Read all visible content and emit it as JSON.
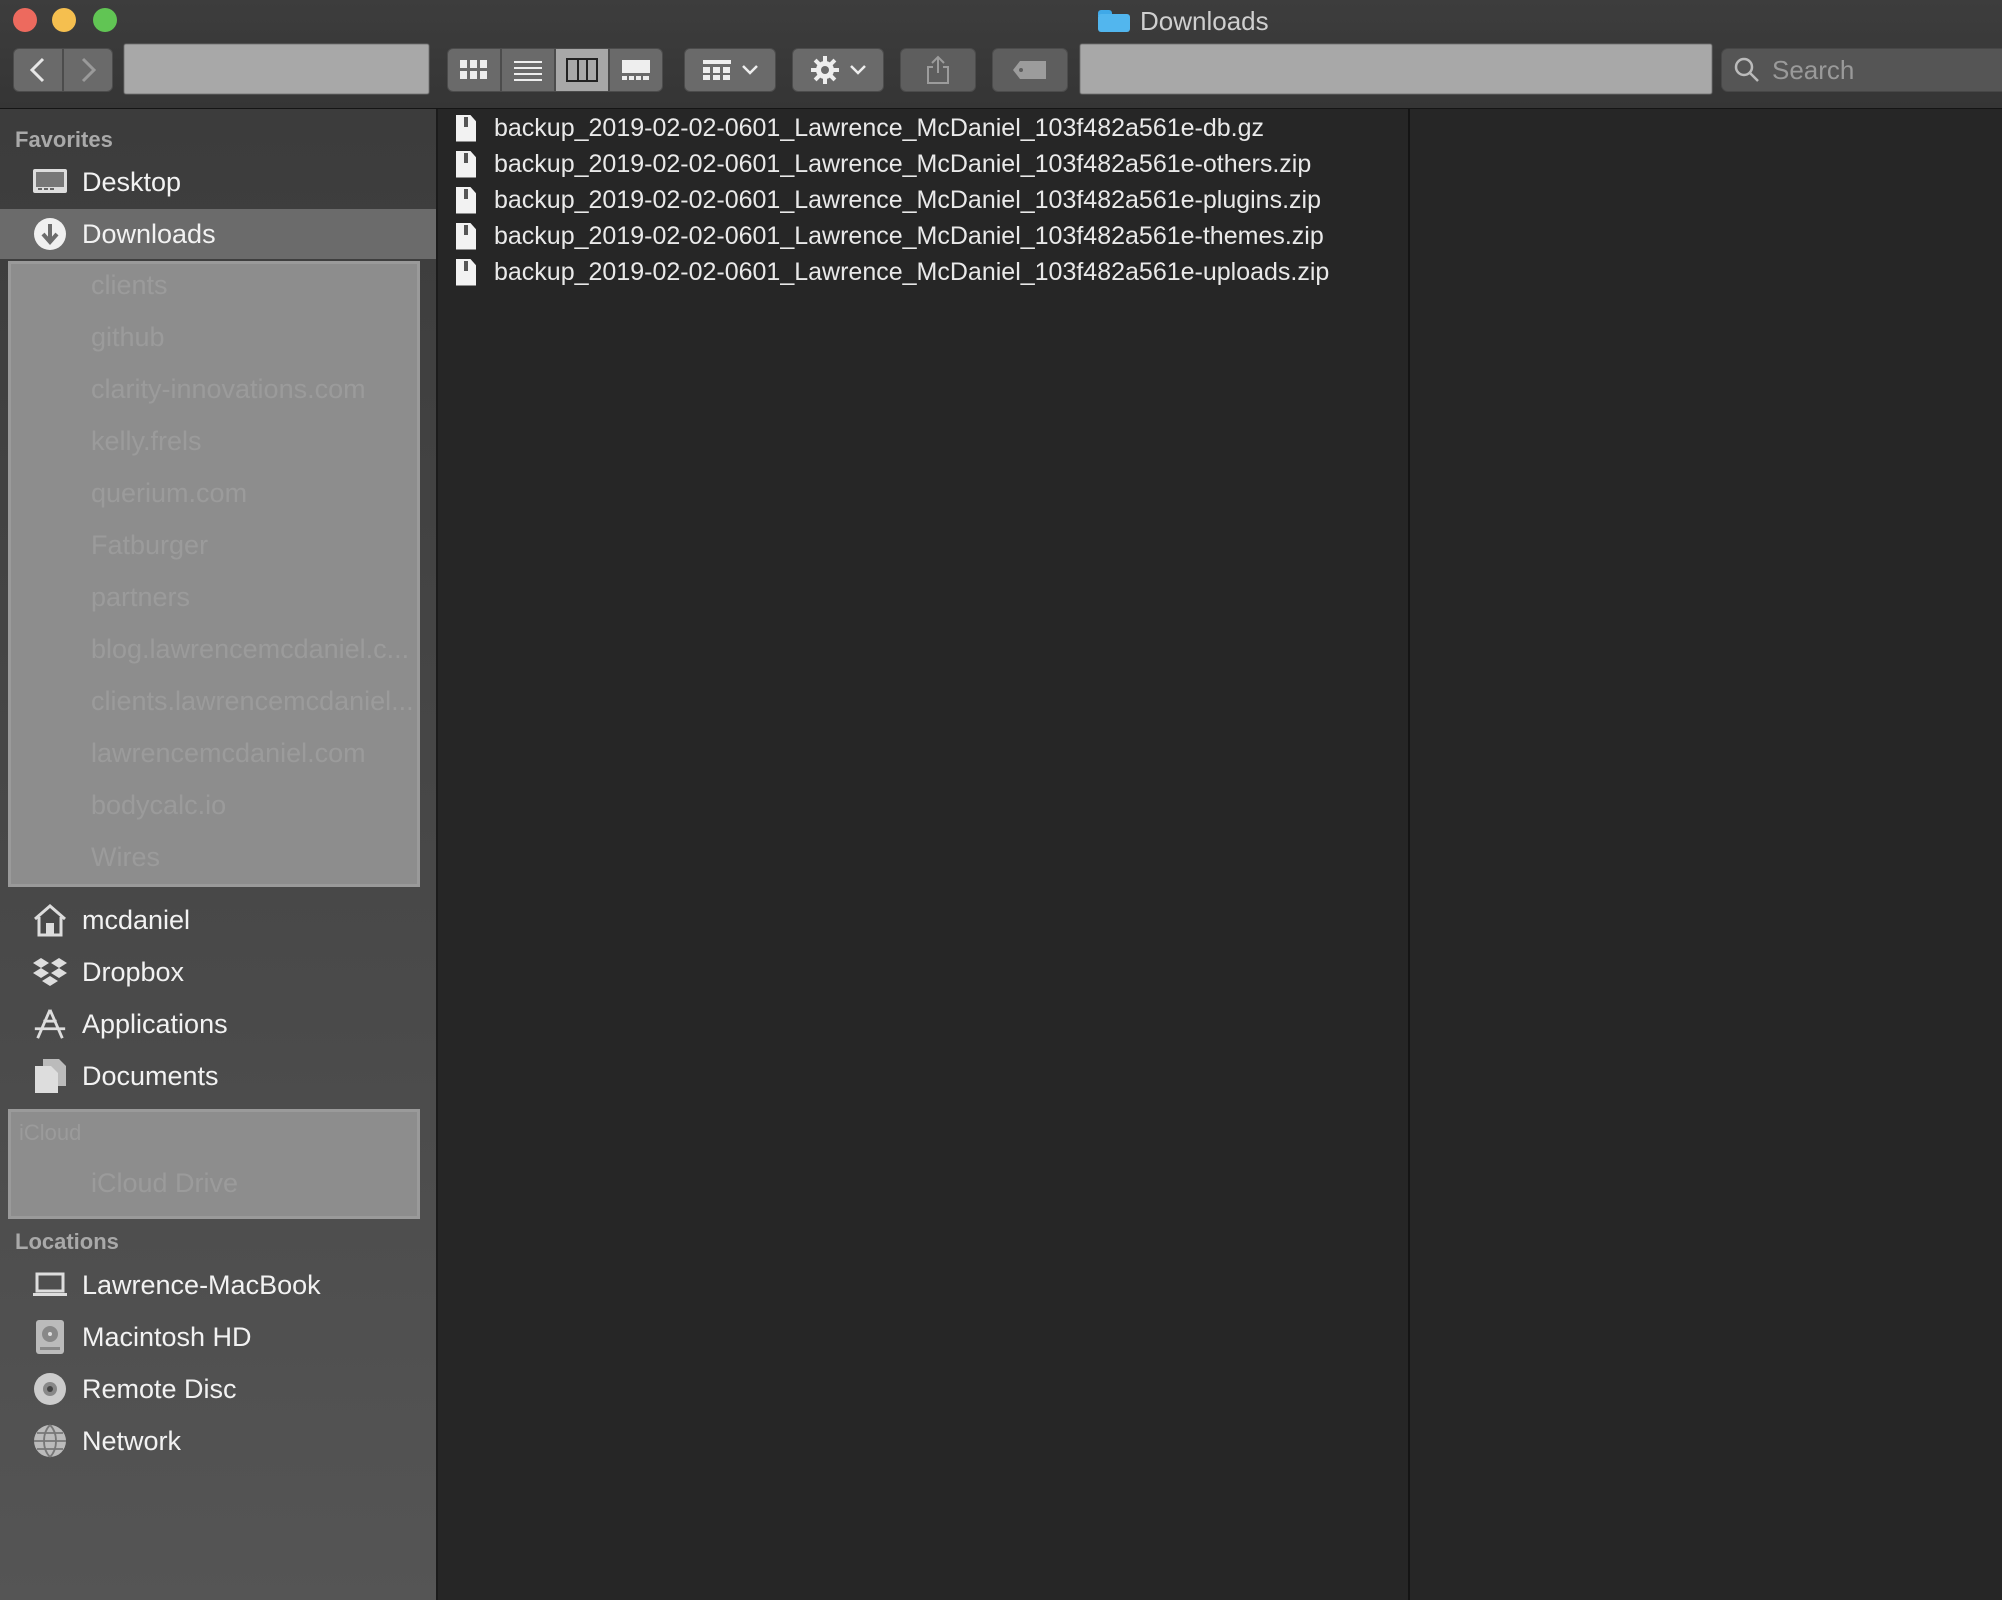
{
  "window": {
    "title": "Downloads"
  },
  "toolbar": {
    "back_icon": "chevron-left-icon",
    "forward_icon": "chevron-right-icon",
    "views": [
      "icon-view",
      "list-view",
      "column-view",
      "gallery-view"
    ],
    "active_view": "column-view",
    "group_icon": "group-by-icon",
    "action_icon": "gear-icon",
    "share_icon": "share-icon",
    "tag_icon": "tag-icon",
    "search_placeholder": "Search"
  },
  "sidebar": {
    "favorites_title": "Favorites",
    "favorites": [
      {
        "label": "Desktop",
        "icon": "desktop-icon"
      },
      {
        "label": "Downloads",
        "icon": "downloads-icon",
        "selected": true
      }
    ],
    "hidden_favorites": [
      "clients",
      "github",
      "clarity-innovations.com",
      "kelly.frels",
      "querium.com",
      "Fatburger",
      "partners",
      "blog.lawrencemcdaniel.c...",
      "clients.lawrencemcdaniel...",
      "lawrencemcdaniel.com",
      "bodycalc.io",
      "Wires"
    ],
    "favorites_more": [
      {
        "label": "mcdaniel",
        "icon": "home-icon"
      },
      {
        "label": "Dropbox",
        "icon": "dropbox-icon"
      },
      {
        "label": "Applications",
        "icon": "applications-icon"
      },
      {
        "label": "Documents",
        "icon": "documents-icon"
      }
    ],
    "icloud_title": "iCloud",
    "icloud_item": "iCloud Drive",
    "locations_title": "Locations",
    "locations": [
      {
        "label": "Lawrence-MacBook",
        "icon": "laptop-icon"
      },
      {
        "label": "Macintosh HD",
        "icon": "hard-drive-icon"
      },
      {
        "label": "Remote Disc",
        "icon": "disc-icon"
      },
      {
        "label": "Network",
        "icon": "network-icon"
      }
    ]
  },
  "files": [
    "backup_2019-02-02-0601_Lawrence_McDaniel_103f482a561e-db.gz",
    "backup_2019-02-02-0601_Lawrence_McDaniel_103f482a561e-others.zip",
    "backup_2019-02-02-0601_Lawrence_McDaniel_103f482a561e-plugins.zip",
    "backup_2019-02-02-0601_Lawrence_McDaniel_103f482a561e-themes.zip",
    "backup_2019-02-02-0601_Lawrence_McDaniel_103f482a561e-uploads.zip"
  ]
}
